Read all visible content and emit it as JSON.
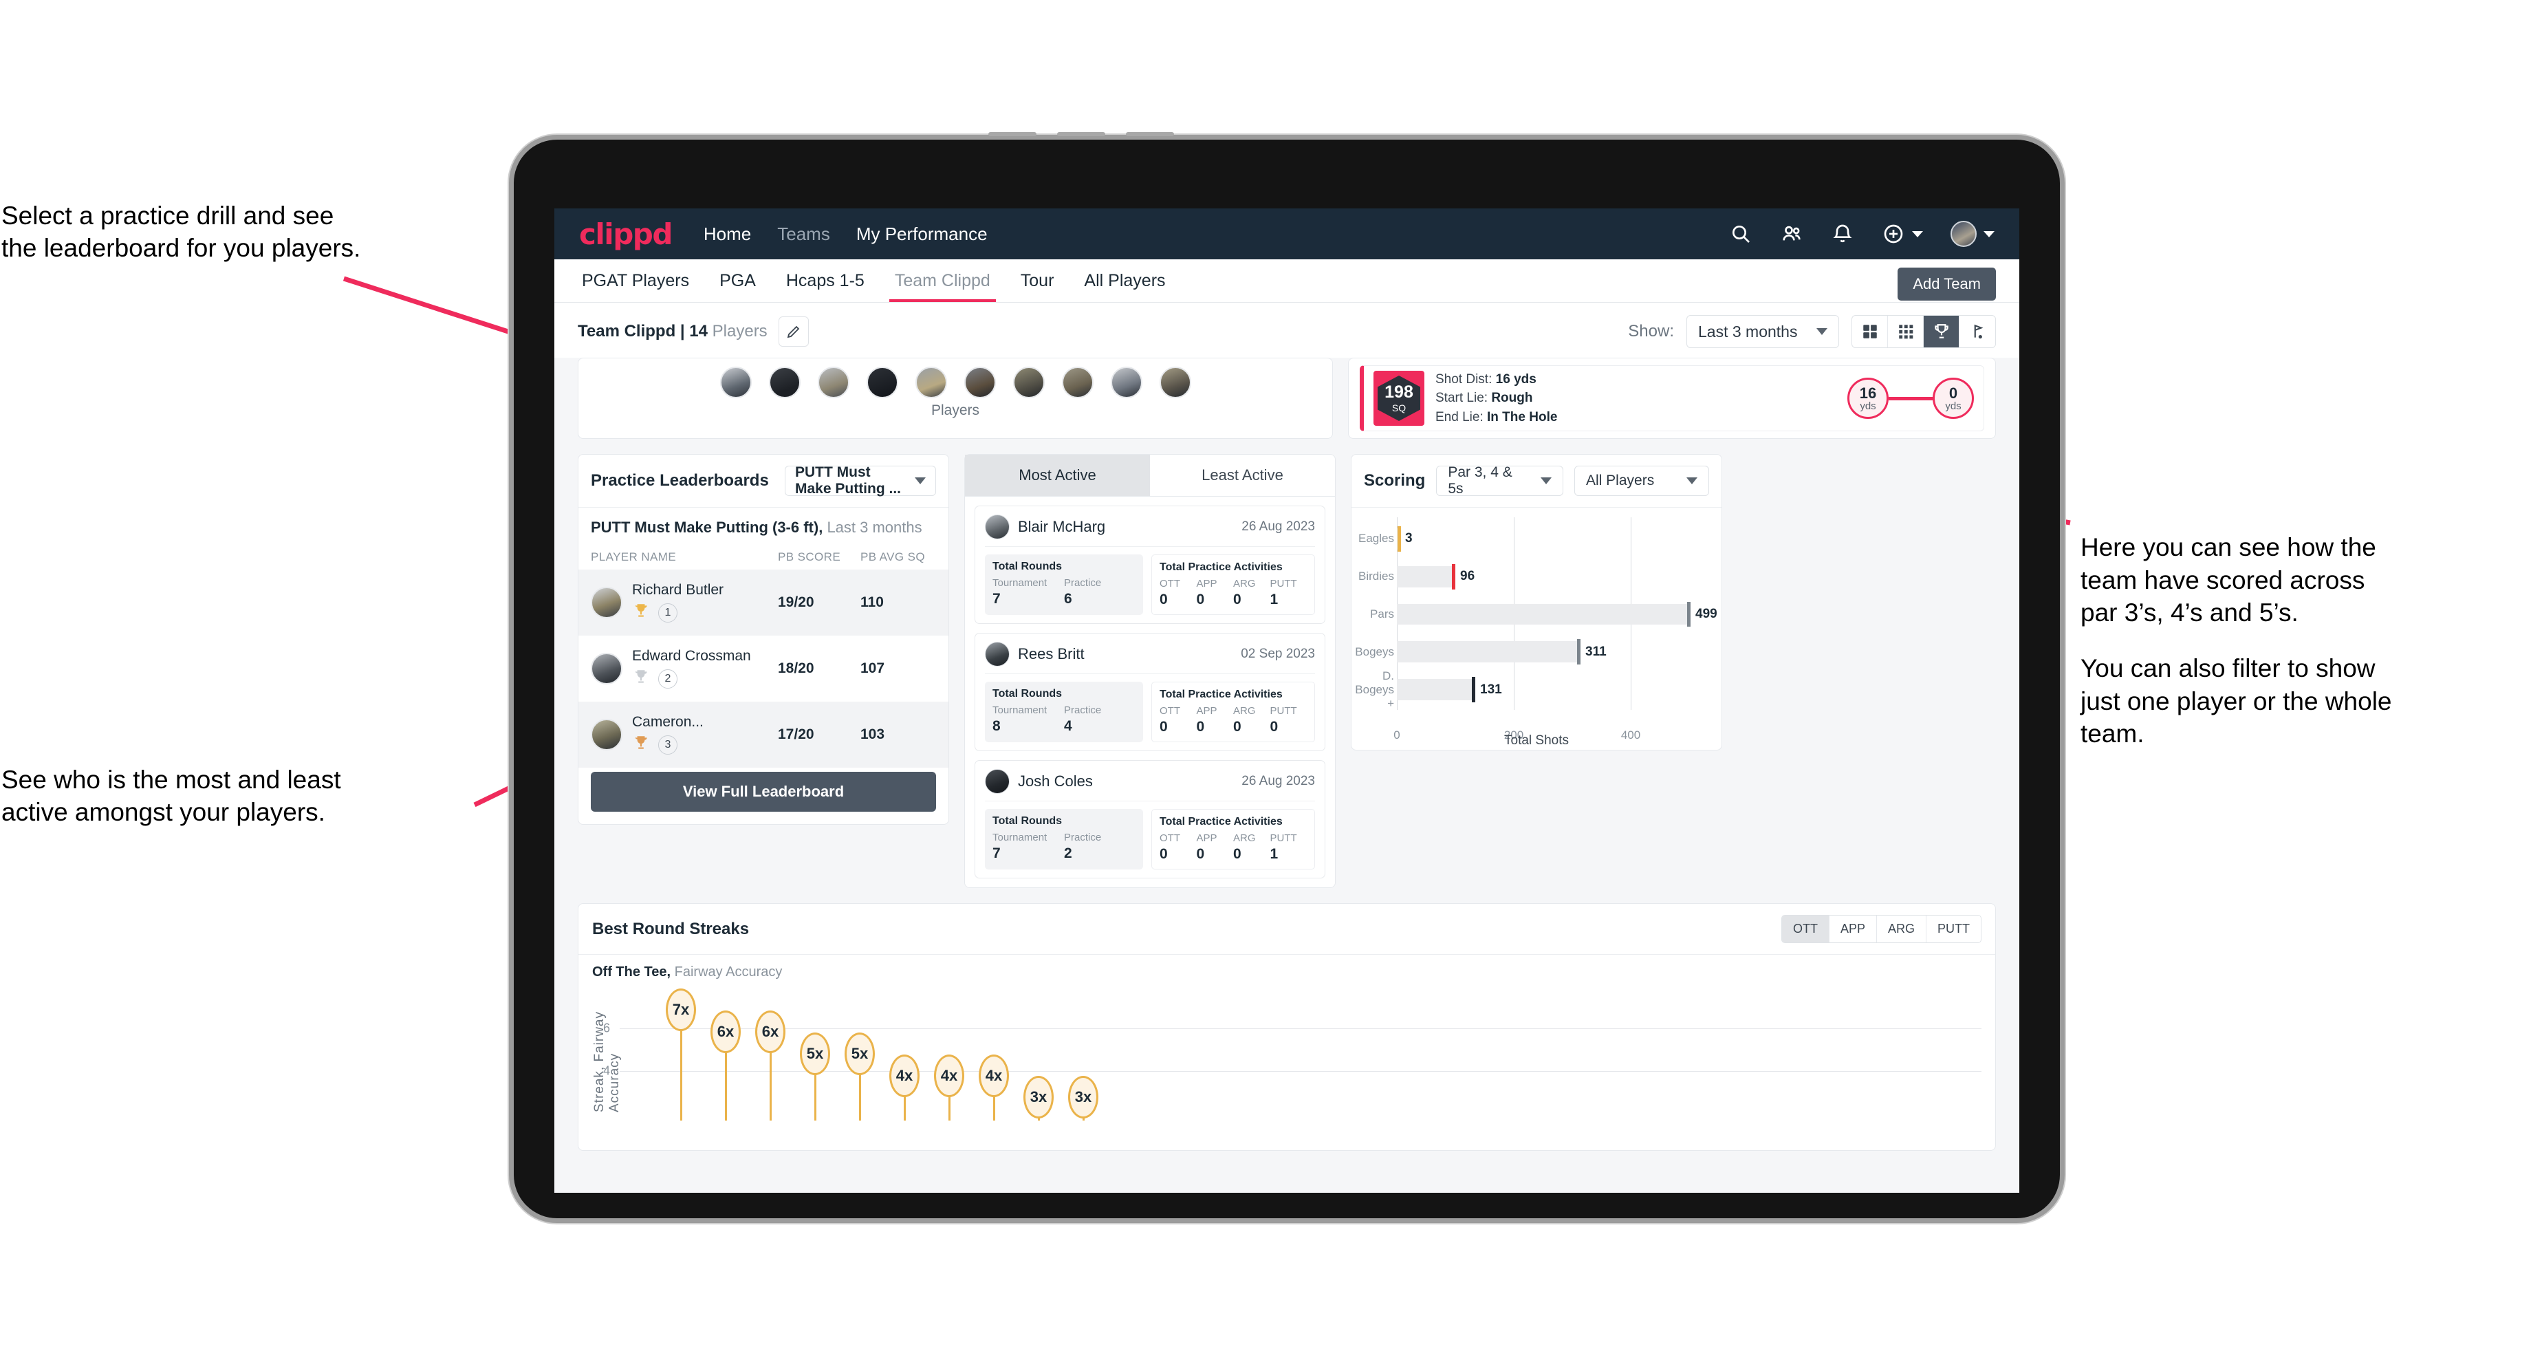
{
  "annotations": {
    "top_left": "Select a practice drill and see\nthe leaderboard for you players.",
    "bottom_left": "See who is the most and least\nactive amongst your players.",
    "right_1": "Here you can see how the\nteam have scored across\npar 3’s, 4’s and 5’s.",
    "right_2": "You can also filter to show\njust one player or the whole\nteam."
  },
  "colors": {
    "brand_pink": "#ef2b5c",
    "navy": "#1b2b3a",
    "slate": "#4c5764",
    "amber": "#eab34a",
    "bar_grey": "#ebecee"
  },
  "topnav": {
    "logo": "clippd",
    "links": [
      {
        "label": "Home",
        "active": true
      },
      {
        "label": "Teams",
        "active": false
      },
      {
        "label": "My Performance",
        "active": true
      }
    ],
    "icons": [
      "search-icon",
      "people-icon",
      "bell-icon",
      "plus-circle-icon",
      "avatar"
    ]
  },
  "tabs": [
    {
      "label": "PGAT Players",
      "active": false
    },
    {
      "label": "PGA",
      "active": false
    },
    {
      "label": "Hcaps 1-5",
      "active": false
    },
    {
      "label": "Team Clippd",
      "active": true
    },
    {
      "label": "Tour",
      "active": false
    },
    {
      "label": "All Players",
      "active": false
    }
  ],
  "add_team_button": "Add Team",
  "subbar": {
    "team_label_bold": "Team Clippd | 14",
    "team_label_rest": " Players",
    "edit_icon": "pencil-icon",
    "show_label": "Show:",
    "show_value": "Last 3 months",
    "view_toggles": [
      {
        "icon": "grid-2x2-icon",
        "active": false
      },
      {
        "icon": "grid-3x3-icon",
        "active": false
      },
      {
        "icon": "trophy-icon",
        "active": true
      },
      {
        "icon": "flag-icon",
        "active": false
      }
    ]
  },
  "players_card": {
    "caption": "Players",
    "avatar_count": 10
  },
  "shot_card": {
    "badge_value": "198",
    "badge_unit": "SQ",
    "lines": [
      {
        "key": "Shot Dist:",
        "value": "16 yds"
      },
      {
        "key": "Start Lie:",
        "value": "Rough"
      },
      {
        "key": "End Lie:",
        "value": "In The Hole"
      }
    ],
    "start_yards": "16",
    "start_unit": "yds",
    "end_yards": "0",
    "end_unit": "yds"
  },
  "leaderboard": {
    "title": "Practice Leaderboards",
    "drill_select": "PUTT Must Make Putting ...",
    "subtitle_bold": "PUTT Must Make Putting (3-6 ft),",
    "subtitle_rest": " Last 3 months",
    "columns": [
      "PLAYER NAME",
      "PB SCORE",
      "PB AVG SQ"
    ],
    "rows": [
      {
        "name": "Richard Butler",
        "rank": "1",
        "medal": "gold",
        "score": "19/20",
        "avg_sq": "110"
      },
      {
        "name": "Edward Crossman",
        "rank": "2",
        "medal": "silver",
        "score": "18/20",
        "avg_sq": "107"
      },
      {
        "name": "Cameron...",
        "rank": "3",
        "medal": "bronze",
        "score": "17/20",
        "avg_sq": "103"
      }
    ],
    "cta": "View Full Leaderboard"
  },
  "activity": {
    "tabs": [
      {
        "label": "Most Active",
        "active": true
      },
      {
        "label": "Least Active",
        "active": false
      }
    ],
    "rounds_label": "Total Rounds",
    "rounds_keys": [
      "Tournament",
      "Practice"
    ],
    "practice_label": "Total Practice Activities",
    "practice_keys": [
      "OTT",
      "APP",
      "ARG",
      "PUTT"
    ],
    "cards": [
      {
        "name": "Blair McHarg",
        "date": "26 Aug 2023",
        "tournament": "7",
        "practice": "6",
        "ott": "0",
        "app": "0",
        "arg": "0",
        "putt": "1"
      },
      {
        "name": "Rees Britt",
        "date": "02 Sep 2023",
        "tournament": "8",
        "practice": "4",
        "ott": "0",
        "app": "0",
        "arg": "0",
        "putt": "0"
      },
      {
        "name": "Josh Coles",
        "date": "26 Aug 2023",
        "tournament": "7",
        "practice": "2",
        "ott": "0",
        "app": "0",
        "arg": "0",
        "putt": "1"
      }
    ]
  },
  "scoring": {
    "title": "Scoring",
    "par_select": "Par 3, 4 & 5s",
    "player_select": "All Players"
  },
  "chart_data": [
    {
      "type": "bar",
      "orientation": "horizontal",
      "title": "Scoring",
      "categories": [
        "Eagles",
        "Birdies",
        "Pars",
        "Bogeys",
        "D. Bogeys +"
      ],
      "values": [
        3,
        96,
        499,
        311,
        131
      ],
      "cap_colors": [
        "#eab34a",
        "#e8323c",
        "#7b848c",
        "#7b848c",
        "#232a33"
      ],
      "xlabel": "Total Shots",
      "ylabel": "",
      "xlim": [
        0,
        560
      ],
      "xticks": [
        0,
        200,
        400
      ],
      "grid": true,
      "legend": "none"
    },
    {
      "type": "lollipop",
      "title": "Best Round Streaks",
      "subtitle_bold": "Off The Tee,",
      "subtitle_rest": " Fairway Accuracy",
      "ylabel": "Streak, Fairway Accuracy",
      "yticks": [
        4,
        6
      ],
      "ylim": [
        0,
        8
      ],
      "grid": true,
      "series_toggle": [
        {
          "label": "OTT",
          "active": true
        },
        {
          "label": "APP",
          "active": false
        },
        {
          "label": "ARG",
          "active": false
        },
        {
          "label": "PUTT",
          "active": false
        }
      ],
      "points": [
        {
          "label": "7x",
          "value": 7
        },
        {
          "label": "6x",
          "value": 6
        },
        {
          "label": "6x",
          "value": 6
        },
        {
          "label": "5x",
          "value": 5
        },
        {
          "label": "5x",
          "value": 5
        },
        {
          "label": "4x",
          "value": 4
        },
        {
          "label": "4x",
          "value": 4
        },
        {
          "label": "4x",
          "value": 4
        },
        {
          "label": "3x",
          "value": 3
        },
        {
          "label": "3x",
          "value": 3
        }
      ]
    }
  ]
}
